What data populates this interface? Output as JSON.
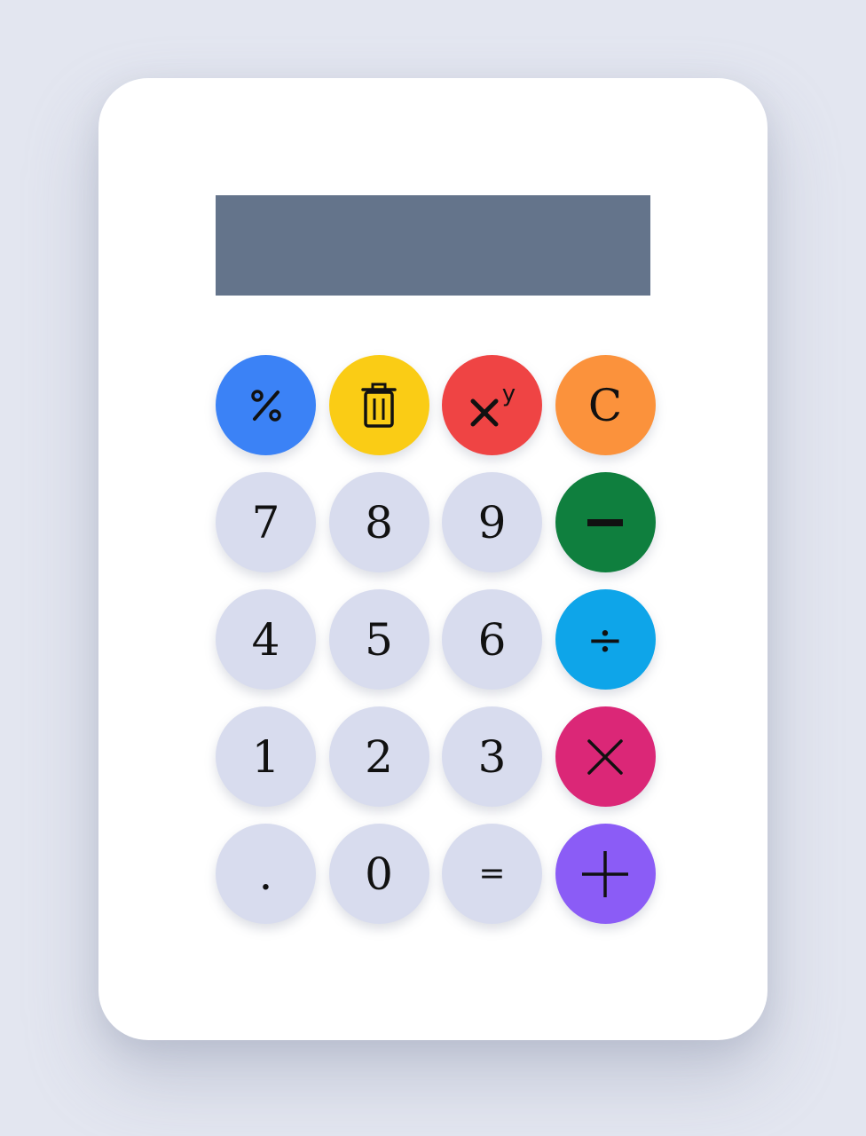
{
  "display": {
    "value": ""
  },
  "colors": {
    "background": "#e3e6f0",
    "card": "#ffffff",
    "display": "#64748b",
    "number_key": "#d8dcee",
    "percent": "#3b82f6",
    "delete": "#facc15",
    "power": "#ef4444",
    "clear": "#fb923c",
    "subtract": "#0f7f3e",
    "divide": "#0ea5e9",
    "multiply": "#db2777",
    "add": "#8b5cf6"
  },
  "keys": {
    "row1": [
      {
        "id": "percent",
        "icon": "percent-icon"
      },
      {
        "id": "delete",
        "icon": "trash-icon"
      },
      {
        "id": "power",
        "icon": "power-icon",
        "label_exp": "y"
      },
      {
        "id": "clear",
        "label": "C"
      }
    ],
    "row2": [
      {
        "id": "seven",
        "label": "7"
      },
      {
        "id": "eight",
        "label": "8"
      },
      {
        "id": "nine",
        "label": "9"
      },
      {
        "id": "subtract",
        "icon": "minus-icon"
      }
    ],
    "row3": [
      {
        "id": "four",
        "label": "4"
      },
      {
        "id": "five",
        "label": "5"
      },
      {
        "id": "six",
        "label": "6"
      },
      {
        "id": "divide",
        "label": "÷"
      }
    ],
    "row4": [
      {
        "id": "one",
        "label": "1"
      },
      {
        "id": "two",
        "label": "2"
      },
      {
        "id": "three",
        "label": "3"
      },
      {
        "id": "multiply",
        "icon": "multiply-icon"
      }
    ],
    "row5": [
      {
        "id": "decimal",
        "label": "."
      },
      {
        "id": "zero",
        "label": "0"
      },
      {
        "id": "equals",
        "label": "="
      },
      {
        "id": "add",
        "icon": "plus-icon"
      }
    ]
  }
}
